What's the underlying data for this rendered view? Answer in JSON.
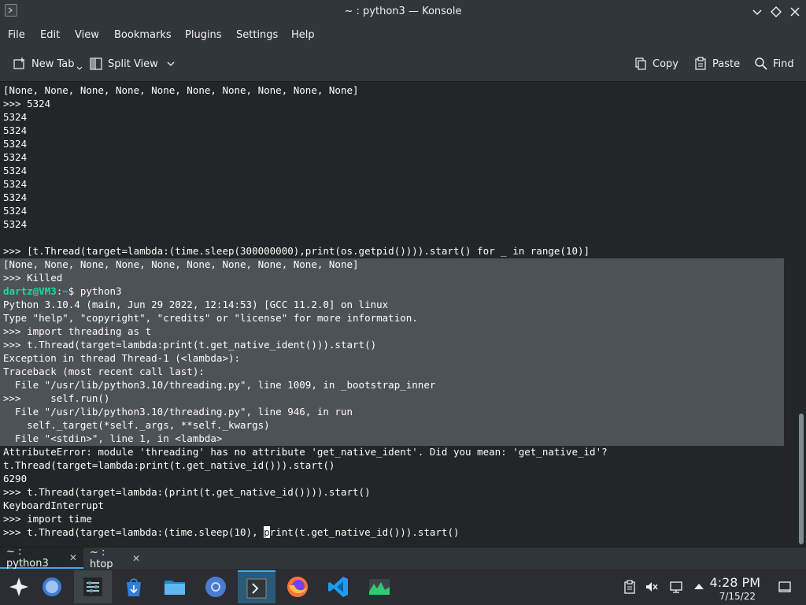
{
  "window": {
    "title": "~ : python3 — Konsole",
    "colors": {
      "chrome": "#31363b",
      "terminal_bg": "#232627",
      "selection": "#4d5257",
      "accent": "#3daee9",
      "prompt_user": "#1cdc9a"
    }
  },
  "menu": {
    "items": [
      "File",
      "Edit",
      "View",
      "Bookmarks",
      "Plugins",
      "Settings",
      "Help"
    ]
  },
  "toolbar": {
    "new_tab": "New Tab",
    "split_view": "Split View",
    "copy": "Copy",
    "paste": "Paste",
    "find": "Find"
  },
  "terminal": {
    "lines": [
      "[None, None, None, None, None, None, None, None, None, None]",
      ">>> 5324",
      "5324",
      "5324",
      "5324",
      "5324",
      "5324",
      "5324",
      "5324",
      "5324",
      "5324",
      "",
      "",
      ">>> [t.Thread(target=lambda:(time.sleep(300000000),print(os.getpid()))).start() for _ in range(10)]",
      "[None, None, None, None, None, None, None, None, None, None]",
      ">>> Killed",
      "",
      "Python 3.10.4 (main, Jun 29 2022, 12:14:53) [GCC 11.2.0] on linux",
      "Type \"help\", \"copyright\", \"credits\" or \"license\" for more information.",
      ">>> import threading as t",
      ">>> t.Thread(target=lambda:print(t.get_native_ident())).start()",
      "Exception in thread Thread-1 (<lambda>):",
      "Traceback (most recent call last):",
      "  File \"/usr/lib/python3.10/threading.py\", line 1009, in _bootstrap_inner",
      ">>>     self.run()",
      "  File \"/usr/lib/python3.10/threading.py\", line 946, in run",
      "    self._target(*self._args, **self._kwargs)",
      "  File \"<stdin>\", line 1, in <lambda>",
      "AttributeError: module 'threading' has no attribute 'get_native_ident'. Did you mean: 'get_native_id'?",
      "t.Thread(target=lambda:print(t.get_native_id())).start()",
      "6290",
      ">>> t.Thread(target=lambda:(print(t.get_native_id()))).start()",
      "KeyboardInterrupt",
      ">>> import time"
    ],
    "prompt": {
      "user": "dartz@VM3",
      "colon": ":",
      "path": "~",
      "dollar": "$ ",
      "command": "python3"
    },
    "current": {
      "before": ">>> t.Thread(target=lambda:(time.sleep(10), ",
      "cursor": "p",
      "after": "rint(t.get_native_id())).start()"
    }
  },
  "tabs": [
    {
      "label": "~ : python3",
      "active": true
    },
    {
      "label": "~ : htop",
      "active": false
    }
  ],
  "taskbar": {
    "time": "4:28 PM",
    "date": "7/15/22",
    "apps": [
      "app-launcher-icon",
      "pager-icon",
      "system-settings-icon",
      "discover-icon",
      "dolphin-icon",
      "chromium-icon",
      "konsole-icon",
      "firefox-icon",
      "vscode-icon",
      "system-monitor-icon"
    ]
  }
}
